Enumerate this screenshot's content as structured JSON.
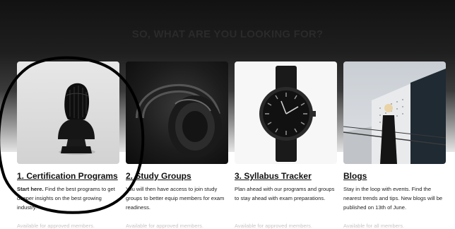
{
  "page": {
    "heading": "SO, WHAT ARE YOU LOOKING FOR?"
  },
  "cards": [
    {
      "title": "1. Certification Programs",
      "desc_lead": "Start here.",
      "desc_rest": " Find the best programs to get deeper insights on the best growing industry.",
      "availability": "Available for approved members.",
      "image_icon": "bust-sculpture-icon"
    },
    {
      "title": "2. Study Groups",
      "desc_lead": "",
      "desc_rest": "You will then have access to join study groups to better equip members for exam readiness.",
      "availability": "Available for approved members.",
      "image_icon": "headphones-icon"
    },
    {
      "title": "3. Syllabus Tracker",
      "desc_lead": "",
      "desc_rest": "Plan ahead with our programs and groups to stay ahead with exam preparations.",
      "availability": "Available for approved members.",
      "image_icon": "wristwatch-icon"
    },
    {
      "title": "Blogs",
      "desc_lead": "",
      "desc_rest": "Stay in the loop with events. Find the nearest trends and tips. New blogs will be published on 13th of June.",
      "availability": "Available for all members.",
      "image_icon": "woman-photo-icon"
    }
  ],
  "colors": {
    "band_top": "#121212",
    "heading": "#2a2a2a",
    "title": "#111111",
    "availability": "#c7c7c7",
    "annotation": "#000000"
  }
}
